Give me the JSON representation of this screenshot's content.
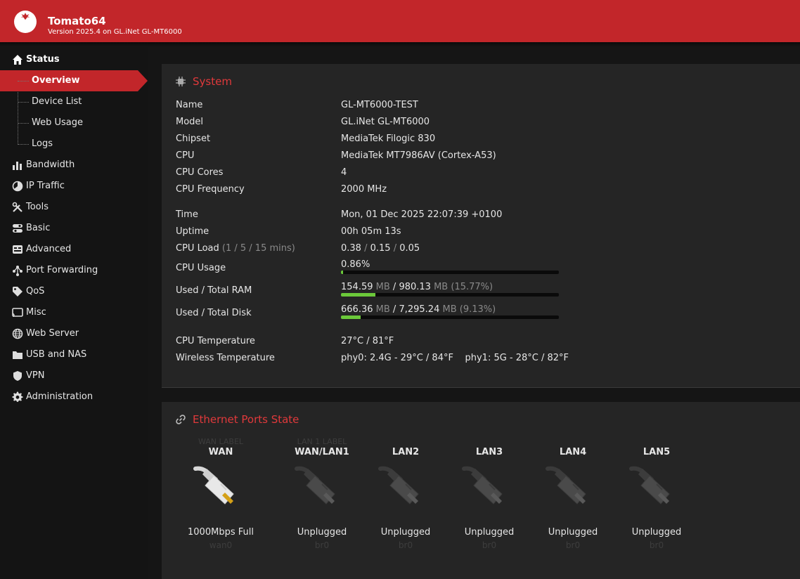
{
  "header": {
    "title": "Tomato64",
    "subtitle": "Version 2025.4 on GL.iNet GL-MT6000"
  },
  "sidebar": {
    "status": "Status",
    "sub_items": [
      "Overview",
      "Device List",
      "Web Usage",
      "Logs"
    ],
    "items": [
      "Bandwidth",
      "IP Traffic",
      "Tools",
      "Basic",
      "Advanced",
      "Port Forwarding",
      "QoS",
      "Misc",
      "Web Server",
      "USB and NAS",
      "VPN",
      "Administration"
    ]
  },
  "system": {
    "title": "System",
    "rows": [
      {
        "label": "Name",
        "value": "GL-MT6000-TEST"
      },
      {
        "label": "Model",
        "value": "GL.iNet GL-MT6000"
      },
      {
        "label": "Chipset",
        "value": "MediaTek Filogic 830"
      },
      {
        "label": "CPU",
        "value": "MediaTek MT7986AV (Cortex-A53)"
      },
      {
        "label": "CPU Cores",
        "value": "4"
      },
      {
        "label": "CPU Frequency",
        "value": "2000 MHz"
      },
      {
        "label": "Time",
        "value": "Mon, 01 Dec 2025 22:07:39 +0100"
      },
      {
        "label": "Uptime",
        "value": "00h 05m 13s"
      }
    ],
    "cpu_load": {
      "label": "CPU Load",
      "hint": "(1 / 5 / 15 mins)",
      "v1": "0.38",
      "v2": "0.15",
      "v3": "0.05",
      "sep": "/"
    },
    "cpu_usage": {
      "label": "CPU Usage",
      "value": "0.86%",
      "fraction": 0.0086
    },
    "ram": {
      "label": "Used / Total RAM",
      "used": "154.59",
      "unit": "MB",
      "sep": "/",
      "total": "980.13",
      "pct": "(15.77%)",
      "fraction": 0.1577
    },
    "disk": {
      "label": "Used / Total Disk",
      "used": "666.36",
      "unit": "MB",
      "sep": "/",
      "total": "7,295.24",
      "pct": "(9.13%)",
      "fraction": 0.0913
    },
    "cpu_temp": {
      "label": "CPU Temperature",
      "value": "27°C / 81°F"
    },
    "wireless_temp": {
      "label": "Wireless Temperature",
      "value": "phy0: 2.4G - 29°C / 84°F    phy1: 5G - 28°C / 82°F"
    }
  },
  "ethernet": {
    "title": "Ethernet Ports State",
    "ports": [
      {
        "ghost": "WAN LABEL",
        "name": "WAN",
        "state": "1000Mbps Full",
        "iface": "wan0",
        "connected": true
      },
      {
        "ghost": "LAN 1 LABEL",
        "name": "WAN/LAN1",
        "state": "Unplugged",
        "iface": "br0",
        "connected": false
      },
      {
        "ghost": "",
        "name": "LAN2",
        "state": "Unplugged",
        "iface": "br0",
        "connected": false
      },
      {
        "ghost": "",
        "name": "LAN3",
        "state": "Unplugged",
        "iface": "br0",
        "connected": false
      },
      {
        "ghost": "",
        "name": "LAN4",
        "state": "Unplugged",
        "iface": "br0",
        "connected": false
      },
      {
        "ghost": "",
        "name": "LAN5",
        "state": "Unplugged",
        "iface": "br0",
        "connected": false
      }
    ]
  },
  "colors": {
    "accent": "#c2262a",
    "title_red": "#e0393b",
    "bar_fill": "#6bc93a"
  }
}
